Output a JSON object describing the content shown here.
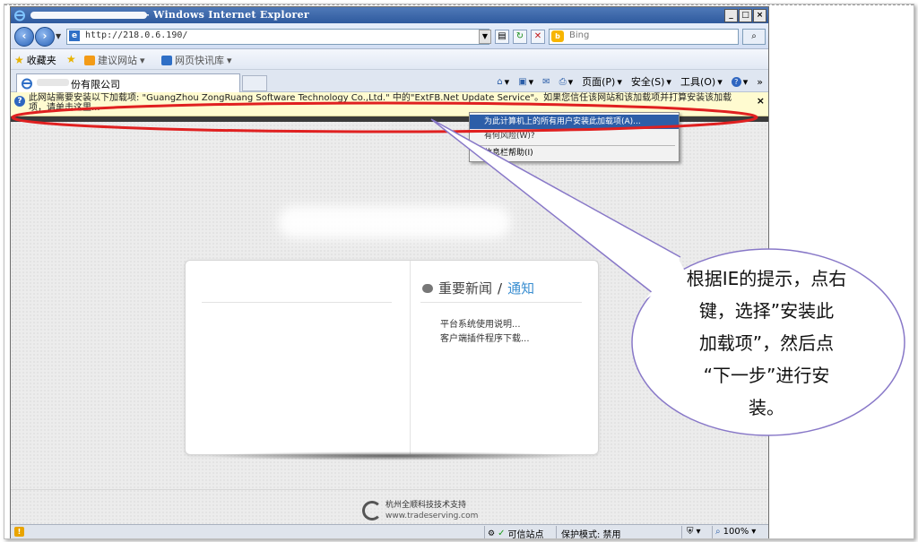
{
  "window": {
    "title_suffix": "- Windows Internet Explorer",
    "min": "_",
    "max": "□",
    "close": "×"
  },
  "address": {
    "url": "http://218.0.6.190/",
    "search_placeholder": "Bing",
    "search_engine_icon": "b"
  },
  "favorites": {
    "label": "收藏夹",
    "items": [
      "建议网站",
      "网页快讯库"
    ]
  },
  "tab": {
    "title": "份有限公司"
  },
  "command_bar": {
    "page": "页面(P)",
    "safety": "安全(S)",
    "tools": "工具(O)",
    "more": "»"
  },
  "info_bar": {
    "message": "此网站需要安装以下加载项: \"GuangZhou ZongRuang Software Technology Co.,Ltd.\" 中的\"ExtFB.Net Update Service\"。如果您信任该网站和该加载项并打算安装该加载项，请单击这里...",
    "close": "×"
  },
  "context_menu": {
    "items": [
      "为此计算机上的所有用户安装此加载项(A)...",
      "有何风险(W)?",
      "信息栏帮助(I)"
    ]
  },
  "page": {
    "news_title": "重要新闻",
    "separator": "/",
    "notice": "通知",
    "links": [
      "平台系统使用说明...",
      "客户端插件程序下载..."
    ],
    "footer_company": "杭州全顺科技技术支持",
    "footer_url": "www.tradeserving.com"
  },
  "status_bar": {
    "trusted": "可信站点",
    "protected_mode": "保护模式: 禁用",
    "zoom": "100%"
  },
  "annotation": {
    "lines": [
      "根据IE的提示，点右",
      "键，选择”安装此",
      "加载项”，然后点",
      "“下一步”进行安",
      "装。"
    ]
  },
  "colors": {
    "ellipse": "#e02020",
    "callout_stroke": "#8878c8",
    "accent": "#2d5ea8"
  }
}
